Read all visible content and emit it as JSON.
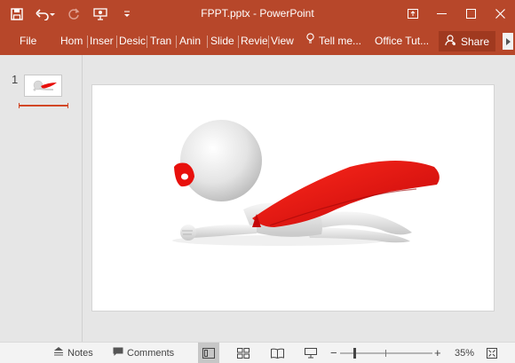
{
  "window": {
    "title": "FPPT.pptx - PowerPoint"
  },
  "colors": {
    "accent": "#b7472a",
    "accent_dark": "#a0391f",
    "cape": "#e8100c"
  },
  "quick_access": [
    "save-icon",
    "undo-icon",
    "redo-icon",
    "present-icon",
    "customize-icon"
  ],
  "ribbon": {
    "tabs": [
      "File",
      "Hom",
      "Inser",
      "Desic",
      "Tran",
      "Anin",
      "Slide",
      "Revie",
      "View"
    ],
    "tell_me": "Tell me...",
    "office_tut": "Office Tut...",
    "share": "Share"
  },
  "slides_pane": {
    "slide_number": "1"
  },
  "statusbar": {
    "notes": "Notes",
    "comments": "Comments",
    "zoom_minus": "−",
    "zoom_plus": "+",
    "zoom": "35%"
  }
}
